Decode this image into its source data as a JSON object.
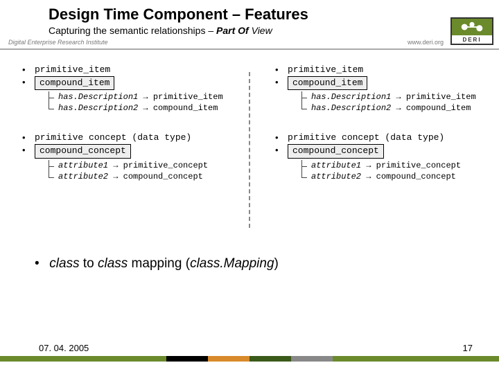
{
  "title": "Design Time Component – Features",
  "subtitle_prefix": "Capturing the semantic relationships – ",
  "subtitle_bold": "Part Of",
  "subtitle_suffix": " View",
  "institute": "Digital Enterprise Research Institute",
  "logo_text": "DERI",
  "url": "www.deri.org",
  "left": {
    "b1": {
      "l1": "primitive_item",
      "l2": "compound_item",
      "sub1a": "has.Description1",
      "sub1b": "primitive_item",
      "sub2a": "has.Description2",
      "sub2b": "compound_item"
    },
    "b2": {
      "l1": "primitive concept (data type)",
      "l2": "compound_concept",
      "sub1a": "attribute1",
      "sub1b": "primitive_concept",
      "sub2a": "attribute2",
      "sub2b": "compound_concept"
    }
  },
  "right": {
    "b1": {
      "l1": "primitive_item",
      "l2": "compound_item",
      "sub1a": "has.Description1",
      "sub1b": "primitive_item",
      "sub2a": "has.Description2",
      "sub2b": "compound_item"
    },
    "b2": {
      "l1": "primitive concept (data type)",
      "l2": "compound_concept",
      "sub1a": "attribute1",
      "sub1b": "primitive_concept",
      "sub2a": "attribute2",
      "sub2b": "compound_concept"
    }
  },
  "arrow": "→",
  "mapping_a": "class",
  "mapping_b": " to ",
  "mapping_c": "class",
  "mapping_d": " mapping (",
  "mapping_e": "class.Mapping",
  "mapping_f": ")",
  "date": "07. 04. 2005",
  "page": "17"
}
